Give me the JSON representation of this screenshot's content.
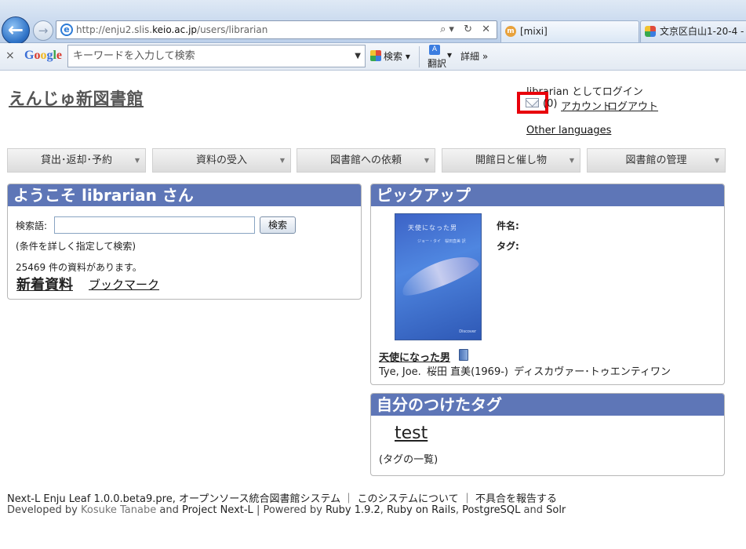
{
  "browser": {
    "url_prefix": "http://enju2.slis.",
    "url_domain": "keio.ac.jp",
    "url_path": "/users/librarian",
    "address_tools": "⌕▾ ↻ ✕",
    "tabs": [
      {
        "label": "[mixi]",
        "favicon": "mixi-icon"
      },
      {
        "label": "文京区白山1-20-4 -",
        "favicon": "google-maps-icon"
      }
    ],
    "google_toolbar": {
      "close": "×",
      "logo_letters": [
        "G",
        "o",
        "o",
        "g",
        "l",
        "e"
      ],
      "search_placeholder": "キーワードを入力して検索",
      "search_button": "検索",
      "translate_button": "翻訳",
      "more_button": "詳細 »"
    }
  },
  "page": {
    "site_title": "えんじゅ新図書館",
    "login_status": "librarian としてログイン",
    "mail_count": "(0)",
    "account_link": "アカウント",
    "logout_link": "ログアウト",
    "other_languages": "Other languages",
    "menu": [
      "貸出･返却･予約",
      "資料の受入",
      "図書館への依頼",
      "開館日と催し物",
      "図書館の管理"
    ],
    "welcome": {
      "heading": "ようこそ librarian さん",
      "search_label": "検索語:",
      "search_button": "検索",
      "advanced_search_open": "(",
      "advanced_search": "条件を詳しく指定して検索",
      "advanced_search_close": ")",
      "count_text": "25469 件の資料があります。",
      "new_items": "新着資料",
      "bookmark": "ブックマーク"
    },
    "pickup": {
      "heading": "ピックアップ",
      "cover_title": "天使になった男",
      "cover_author": "ジョー・タイ　桜田直美 訳",
      "cover_publisher": "Discover",
      "subject_label": "件名:",
      "tag_label": "タグ:",
      "book_title": "天使になった男",
      "creators": [
        "Tye, Joe.",
        "桜田 直美(1969-)",
        "ディスカヴァー･トゥエンティワン"
      ]
    },
    "my_tags": {
      "heading": "自分のつけたタグ",
      "tag": "test",
      "list_open": "(",
      "list_link": "タグの一覧",
      "list_close": ")"
    },
    "footer": {
      "line1": {
        "product": "Next-L Enju Leaf 1.0.0.beta9.pre",
        "desc": ", オープンソース統合図書館システム ｜",
        "about": "このシステムについて",
        "sep": "｜",
        "report": "不具合を報告する"
      },
      "line2": {
        "developed_by": "Developed by ",
        "author": "Kosuke Tanabe",
        "and": " and ",
        "project": "Project Next-L",
        "powered": " | Powered by ",
        "ruby": "Ruby 1.9.2",
        "comma1": ", ",
        "rails": "Ruby on Rails",
        "comma2": ", ",
        "postgres": "PostgreSQL",
        "and2": " and ",
        "solr": "Solr"
      }
    }
  },
  "colors": {
    "panel_header": "#5e76b7",
    "highlight_box": "#e8000b"
  }
}
